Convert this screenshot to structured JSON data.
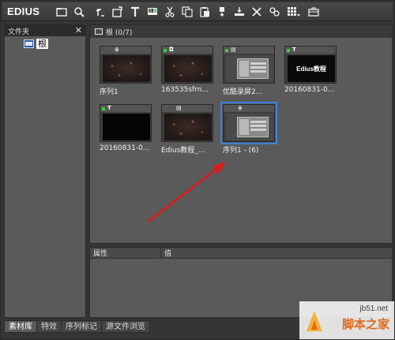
{
  "app": {
    "name": "EDIUS"
  },
  "toolbar": {
    "icons": [
      "new-folder-icon",
      "search-icon",
      "up-folder-icon",
      "add-clip-icon",
      "title-icon",
      "color-bars-icon",
      "cut-icon",
      "copy-icon",
      "paste-icon",
      "add-to-timeline-icon",
      "insert-icon",
      "delete-icon",
      "properties-icon",
      "view-mode-icon",
      "tools-icon"
    ]
  },
  "folder_panel": {
    "title": "文件夹",
    "close": "✕",
    "root_label": "根"
  },
  "bin": {
    "header": "根 (0/7)",
    "clips": [
      {
        "label": "序列1",
        "type": "sequence",
        "thumb": "stars",
        "marker": false
      },
      {
        "label": "163535sfrn...",
        "type": "still",
        "thumb": "stars",
        "marker": true
      },
      {
        "label": "优酷录屏2...",
        "type": "video",
        "thumb": "screen",
        "marker": true
      },
      {
        "label": "20160831-0...",
        "type": "title",
        "thumb": "title",
        "marker": true,
        "thumb_text": "Edius教程"
      },
      {
        "label": "20160831-0...",
        "type": "title",
        "thumb": "black",
        "marker": true
      },
      {
        "label": "Edius教程_...",
        "type": "video",
        "thumb": "stars",
        "marker": false
      },
      {
        "label": "序列1 - (6)",
        "type": "sequence",
        "thumb": "screen",
        "marker": false,
        "selected": true
      }
    ]
  },
  "properties": {
    "col_property": "属性",
    "col_value": "值"
  },
  "tabs": [
    {
      "label": "素材库",
      "active": true
    },
    {
      "label": "特效",
      "active": false
    },
    {
      "label": "序列标记",
      "active": false
    },
    {
      "label": "源文件浏览",
      "active": false
    }
  ],
  "watermark": {
    "site": "jb51.net",
    "name": "脚本之家"
  },
  "colors": {
    "selection": "#3d82dc",
    "arrow": "#e01818",
    "marker": "#36d136"
  }
}
